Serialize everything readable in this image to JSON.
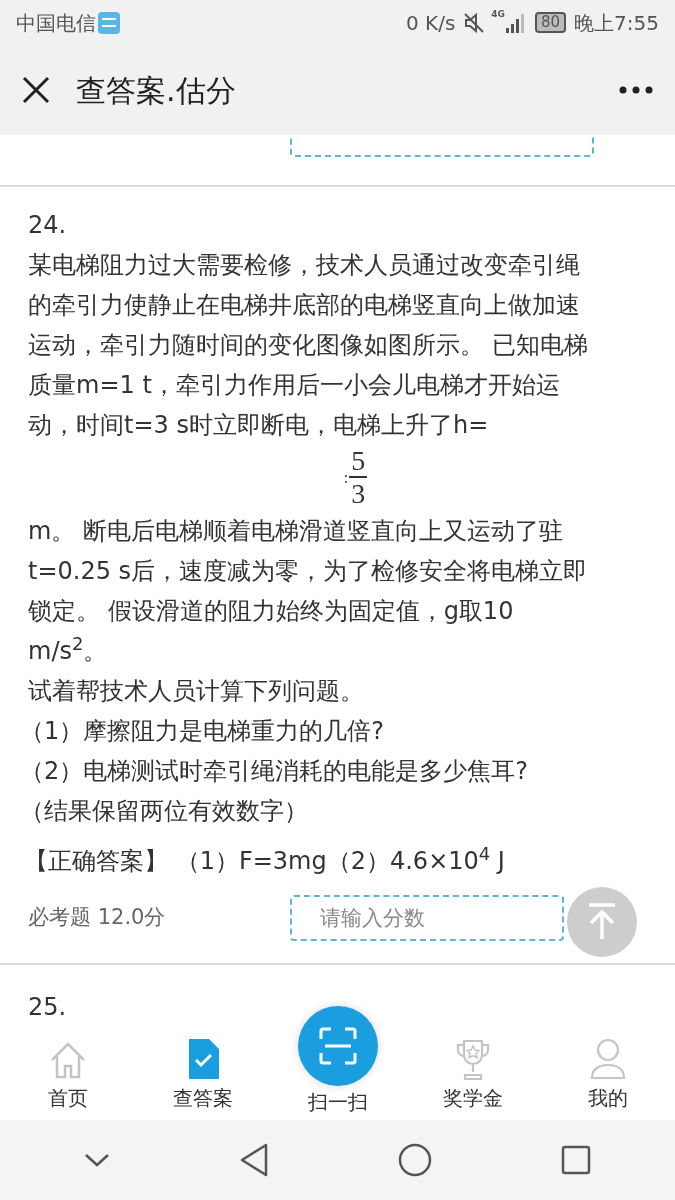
{
  "status_bar": {
    "carrier": "中国电信",
    "speed": "0 K/s",
    "network": "4G",
    "battery": "80",
    "time": "晚上7:55"
  },
  "header": {
    "title": "查答案.估分"
  },
  "questions": [
    {
      "kind": "cut"
    },
    {
      "kind": "full",
      "number": "24.",
      "text_before": "某电梯阻力过大需要检修，技术人员通过改变牵引绳的牵引力使静止在电梯井底部的电梯竖直向上做加速运动，牵引力随时间的变化图像如图所示。 已知电梯质量m=1 t，牵引力作用后一小会儿电梯才开始运动，时间t=3 s时立即断电，电梯上升了h=",
      "fraction": {
        "prefix": ":",
        "numerator": "5",
        "denominator": "3"
      },
      "text_after": "m。 断电后电梯顺着电梯滑道竖直向上又运动了驻t=0.25 s后，速度减为零，为了检修安全将电梯立即锁定。 假设滑道的阻力始终为固定值，g取10 m/s$^{2}$。",
      "lines": [
        "试着帮技术人员计算下列问题。",
        "（1）摩擦阻力是电梯重力的几倍?",
        "（2）电梯测试时牵引绳消耗的电能是多少焦耳?",
        "（结果保留两位有效数字）"
      ],
      "answer": "【正确答案】 （1）F=3mg（2）4.6×10$^{4}$ J",
      "score_label": "必考题 12.0分",
      "score_placeholder": "请输入分数"
    },
    {
      "kind": "head",
      "number": "25."
    }
  ],
  "tabs": [
    {
      "label": "首页",
      "selected": false
    },
    {
      "label": "查答案",
      "selected": true
    },
    {
      "label": "扫一扫",
      "selected": false
    },
    {
      "label": "奖学金",
      "selected": false
    },
    {
      "label": "我的",
      "selected": false
    }
  ]
}
